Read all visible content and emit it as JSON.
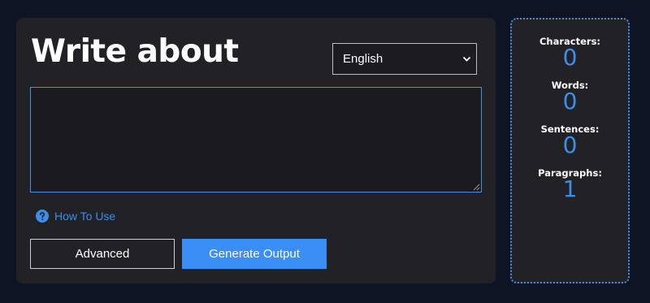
{
  "editor": {
    "title": "Write about",
    "language_select": {
      "selected": "English"
    },
    "textarea": {
      "value": "",
      "placeholder": ""
    },
    "how_to_use_label": "How To Use",
    "advanced_label": "Advanced",
    "generate_label": "Generate Output"
  },
  "stats": [
    {
      "label": "Characters:",
      "value": "0"
    },
    {
      "label": "Words:",
      "value": "0"
    },
    {
      "label": "Sentences:",
      "value": "0"
    },
    {
      "label": "Paragraphs:",
      "value": "1"
    }
  ],
  "colors": {
    "page_background": "#0f1424",
    "panel_background": "#222226",
    "accent_blue": "#3a8ef6",
    "link_blue": "#3b8eea",
    "text_white": "#ffffff"
  },
  "icons": {
    "select_chevron": "chevron-down-icon",
    "help": "question-circle-icon",
    "resize": "resize-grip-icon"
  }
}
